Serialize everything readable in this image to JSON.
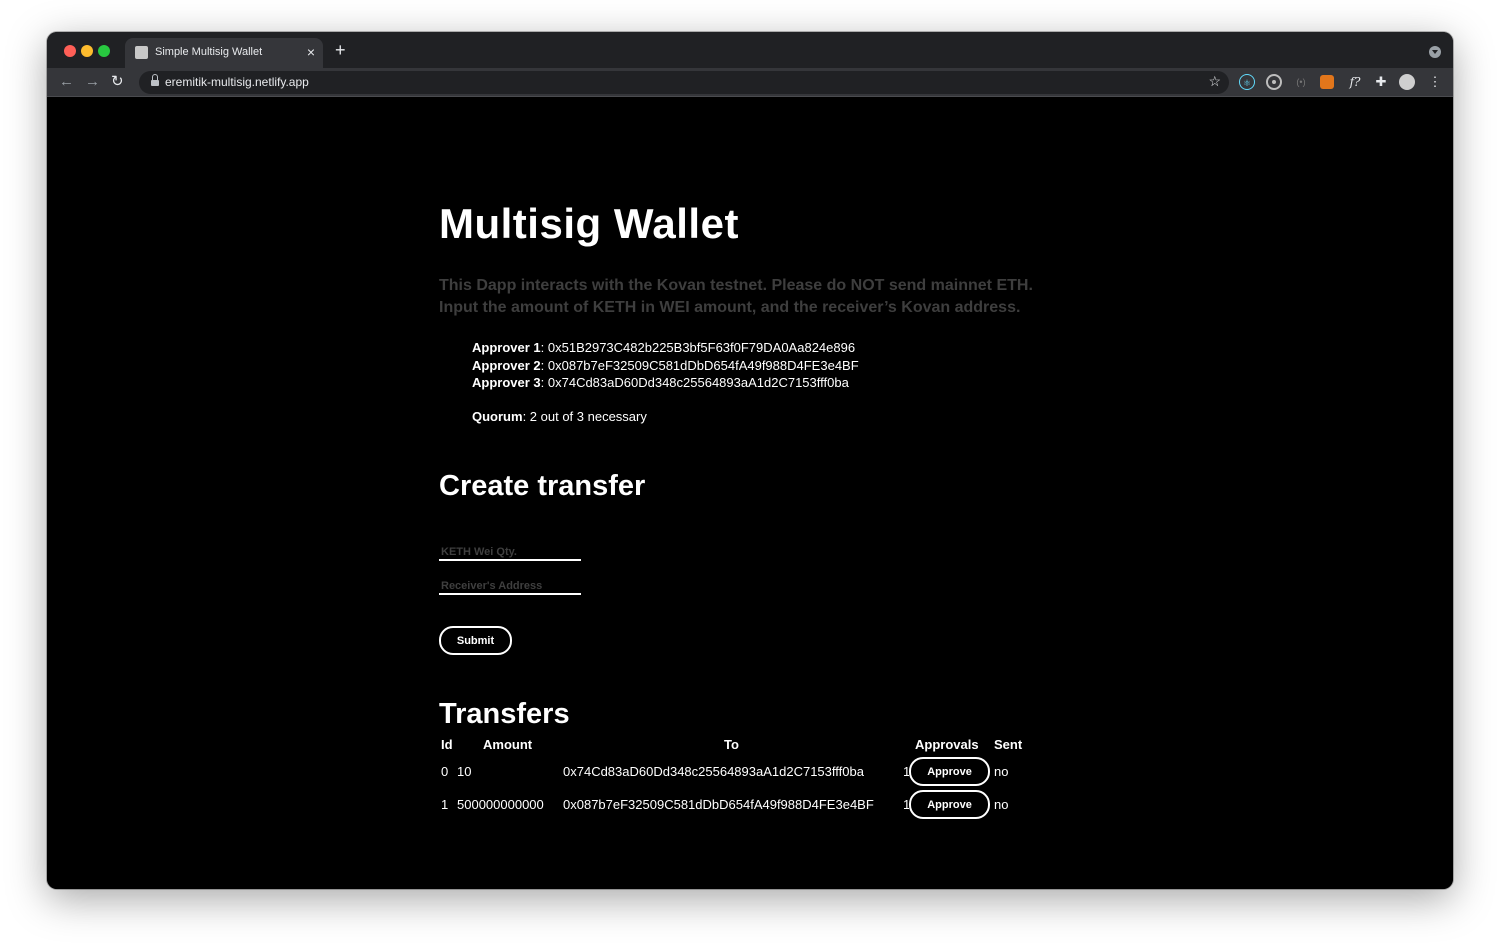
{
  "browser": {
    "tab_title": "Simple Multisig Wallet",
    "tab_close": "×",
    "new_tab": "+",
    "url": "eremitik-multisig.netlify.app",
    "nav_back": "←",
    "nav_forward": "→",
    "nav_reload": "↻",
    "star": "☆",
    "extensions": {
      "react": "⚛",
      "signal": "(•)",
      "func": "f?",
      "puzzle": "✚",
      "more": "⋮"
    }
  },
  "page": {
    "title": "Multisig Wallet",
    "intro_line1": "This Dapp interacts with the Kovan testnet. Please do NOT send mainnet ETH.",
    "intro_line2": "Input the amount of KETH in WEI amount, and the receiver’s Kovan address.",
    "approvers": [
      {
        "label": "Approver 1",
        "address": "0x51B2973C482b225B3bf5F63f0F79DA0Aa824e896"
      },
      {
        "label": "Approver 2",
        "address": "0x087b7eF32509C581dDbD654fA49f988D4FE3e4BF"
      },
      {
        "label": "Approver 3",
        "address": "0x74Cd83aD60Dd348c25564893aA1d2C7153fff0ba"
      }
    ],
    "quorum": {
      "label": "Quorum",
      "value": "2 out of 3 necessary"
    },
    "create": {
      "title": "Create transfer",
      "qty_placeholder": "KETH Wei Qty.",
      "qty_value": "",
      "address_placeholder": "Receiver's Address",
      "address_value": "",
      "submit_label": "Submit"
    },
    "transfers": {
      "title": "Transfers",
      "headers": {
        "id": "Id",
        "amount": "Amount",
        "to": "To",
        "approvals": "Approvals",
        "sent": "Sent"
      },
      "rows": [
        {
          "id": "0",
          "amount": "10",
          "to": "0x74Cd83aD60Dd348c25564893aA1d2C7153fff0ba",
          "approvals": "1",
          "approve_label": "Approve",
          "sent": "no"
        },
        {
          "id": "1",
          "amount": "500000000000",
          "to": "0x087b7eF32509C581dDbD654fA49f988D4FE3e4BF",
          "approvals": "1",
          "approve_label": "Approve",
          "sent": "no"
        }
      ]
    }
  }
}
